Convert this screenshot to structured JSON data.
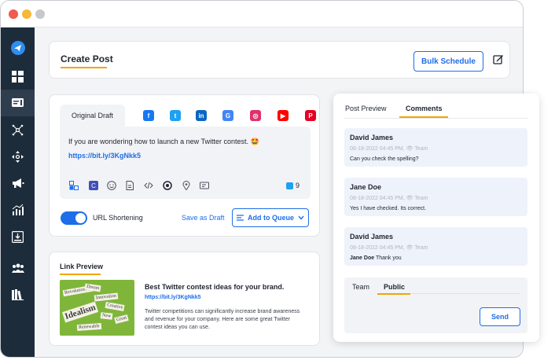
{
  "create": {
    "title": "Create Post",
    "bulk_label": "Bulk Schedule"
  },
  "draft": {
    "tab_label": "Original Draft",
    "text": "If you are wondering how to launch a new Twitter contest. 🤩",
    "link": "https://bit.ly/3KgNkk5",
    "char_count": "9",
    "url_shortening_label": "URL Shortening",
    "url_shortening_on": true,
    "save_draft_label": "Save as Draft",
    "queue_label": "Add to Queue",
    "networks": [
      "facebook-icon",
      "twitter-icon",
      "linkedin-icon",
      "google-business-icon",
      "instagram-icon",
      "youtube-icon",
      "pinterest-icon"
    ]
  },
  "link_preview": {
    "title": "Link Preview",
    "headline": "Best Twitter contest ideas for your brand.",
    "url": "https://bit.ly/3KgNkk5",
    "description": "Twitter competitions can significantly increase brand awareness and revenue for your company. Here are some great Twitter contest ideas you can use.",
    "image_words": [
      "Revolutionary",
      "Dream",
      "Innovation",
      "Idealism",
      "Creative",
      "Renewable",
      "Great",
      "New"
    ]
  },
  "panel": {
    "tab_preview": "Post Preview",
    "tab_comments": "Comments",
    "comments": [
      {
        "name": "David James",
        "meta": "08-18-2022 04:45 PM, 👁 Team",
        "mention": "",
        "text": "Can you check the spelling?"
      },
      {
        "name": "Jane Doe",
        "meta": "08-18-2022 04:45 PM, 👁 Team",
        "mention": "",
        "text": "Yes I have checked. Its correct."
      },
      {
        "name": "David James",
        "meta": "08-18-2022 04:45 PM, 👁 Team",
        "mention": "Jane Doe",
        "text": "Thank you"
      }
    ],
    "reply_tab_team": "Team",
    "reply_tab_public": "Public",
    "send_label": "Send"
  },
  "colors": {
    "accent": "#1d6ee8",
    "sidebar": "#1d2c3b",
    "highlight": "#f0a500"
  }
}
